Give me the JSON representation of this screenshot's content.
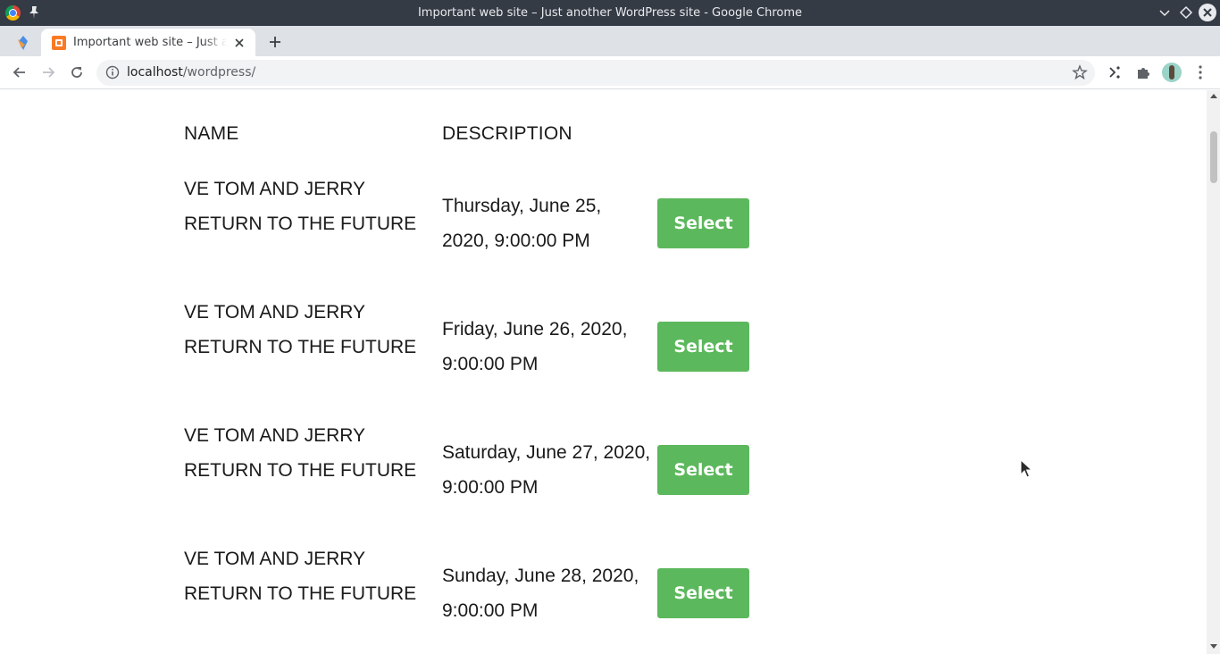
{
  "window": {
    "title": "Important web site – Just another WordPress site - Google Chrome"
  },
  "tabs": [
    {
      "title": "Important web site – Just another WordPress site",
      "active": true
    }
  ],
  "address_bar": {
    "host": "localhost",
    "path": "/wordpress/"
  },
  "table": {
    "headers": {
      "name": "NAME",
      "description": "DESCRIPTION"
    },
    "rows": [
      {
        "name": "VE TOM AND JERRY RETURN TO THE FUTURE",
        "date": "Thursday, June 25, 2020, 9:00:00 PM",
        "button": "Select"
      },
      {
        "name": "VE TOM AND JERRY RETURN TO THE FUTURE",
        "date": "Friday, June 26, 2020, 9:00:00 PM",
        "button": "Select"
      },
      {
        "name": "VE TOM AND JERRY RETURN TO THE FUTURE",
        "date": "Saturday, June 27, 2020, 9:00:00 PM",
        "button": "Select"
      },
      {
        "name": "VE TOM AND JERRY RETURN TO THE FUTURE",
        "date": "Sunday, June 28, 2020, 9:00:00 PM",
        "button": "Select"
      }
    ]
  },
  "colors": {
    "button_bg": "#5cb85c",
    "titlebar_bg": "#353b45",
    "tabstrip_bg": "#dee1e6"
  },
  "icons": [
    "chrome-icon",
    "pin-icon",
    "minimize-icon",
    "maximize-icon",
    "close-icon",
    "back-icon",
    "forward-icon",
    "reload-icon",
    "info-icon",
    "star-icon",
    "cast-icon",
    "extensions-icon",
    "menu-icon",
    "plus-icon"
  ]
}
